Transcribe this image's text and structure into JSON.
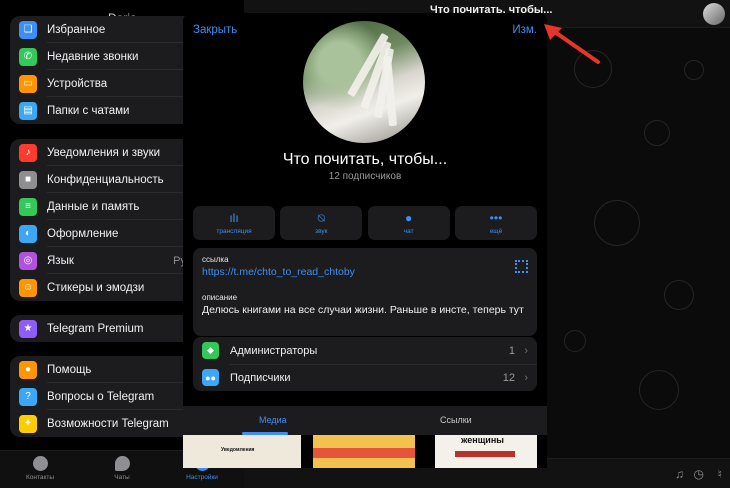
{
  "sidebar": {
    "title": "Daria",
    "groups": [
      {
        "items": [
          {
            "label": "Избранное",
            "icon": "bookmark-icon",
            "color": "#3e8ff2"
          },
          {
            "label": "Недавние звонки",
            "icon": "phone-icon",
            "color": "#34c759"
          },
          {
            "label": "Устройства",
            "icon": "devices-icon",
            "color": "#ff9500"
          },
          {
            "label": "Папки с чатами",
            "icon": "folder-icon",
            "color": "#3ba7f5"
          }
        ]
      },
      {
        "items": [
          {
            "label": "Уведомления и звуки",
            "icon": "bell-icon",
            "color": "#ff3b30"
          },
          {
            "label": "Конфиденциальность",
            "icon": "lock-icon",
            "color": "#8e8e93"
          },
          {
            "label": "Данные и память",
            "icon": "data-icon",
            "color": "#34c759"
          },
          {
            "label": "Оформление",
            "icon": "appearance-icon",
            "color": "#3ba7f5"
          },
          {
            "label": "Язык",
            "icon": "globe-icon",
            "color": "#af52de",
            "value": "Ру"
          },
          {
            "label": "Стикеры и эмодзи",
            "icon": "sticker-icon",
            "color": "#ff9500"
          }
        ]
      },
      {
        "items": [
          {
            "label": "Telegram Premium",
            "icon": "star-icon",
            "color": "#8e5cf6"
          }
        ]
      },
      {
        "items": [
          {
            "label": "Помощь",
            "icon": "help-icon",
            "color": "#ff9500"
          },
          {
            "label": "Вопросы о Telegram",
            "icon": "question-icon",
            "color": "#3ba7f5"
          },
          {
            "label": "Возможности Telegram",
            "icon": "lightbulb-icon",
            "color": "#ffcc00"
          }
        ]
      }
    ]
  },
  "tabbar": {
    "contacts_label": "Контакты",
    "chats_label": "Чаты",
    "settings_label": "Настройки"
  },
  "chat": {
    "header_title": "Что почитать, чтобы..."
  },
  "modal": {
    "close_label": "Закрыть",
    "edit_label": "Изм.",
    "channel_name": "Что почитать, чтобы...",
    "subscribers": "12 подписчиков",
    "actions": [
      {
        "label": "трансляция",
        "icon": "broadcast-icon"
      },
      {
        "label": "звук",
        "icon": "mute-icon"
      },
      {
        "label": "чат",
        "icon": "chat-bubble-icon"
      },
      {
        "label": "ещё",
        "icon": "more-icon"
      }
    ],
    "link_label": "ссылка",
    "link_value": "https://t.me/chto_to_read_chtoby",
    "description_label": "описание",
    "description_value": "Делюсь книгами на все случаи жизни. Раньше в инсте, теперь тут",
    "admins": {
      "label": "Администраторы",
      "count": "1"
    },
    "subscribers_row": {
      "label": "Подписчики",
      "count": "12"
    },
    "tabs": [
      "Медиа",
      "Ссылки"
    ],
    "media_thumbs": [
      {
        "text": "Уведомления"
      },
      {
        "text": ""
      },
      {
        "text": "женщины"
      }
    ]
  },
  "colors": {
    "accent": "#3e8ff2",
    "annotation_arrow": "#e8352b"
  }
}
